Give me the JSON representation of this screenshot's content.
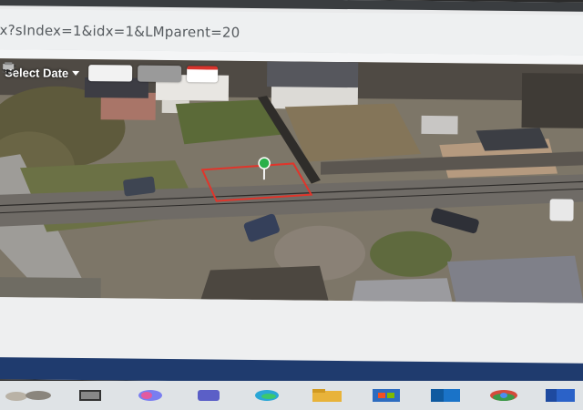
{
  "browser": {
    "url_fragment": "x?sIndex=1&idx=1&LMparent=20"
  },
  "map": {
    "toolbar": {
      "select_date_label": "Select Date",
      "layers_icon": "layers-icon",
      "pin_icon": "pin-icon",
      "print_icon": "print-icon"
    },
    "parcel_highlight_color": "#e0352b",
    "marker_color": "#2bb04a"
  },
  "taskbar": {
    "icons": [
      "weather-icon",
      "task-view-icon",
      "copilot-icon",
      "teams-icon",
      "edge-icon",
      "file-explorer-icon",
      "store-icon",
      "outlook-icon",
      "chrome-icon",
      "word-icon"
    ]
  }
}
